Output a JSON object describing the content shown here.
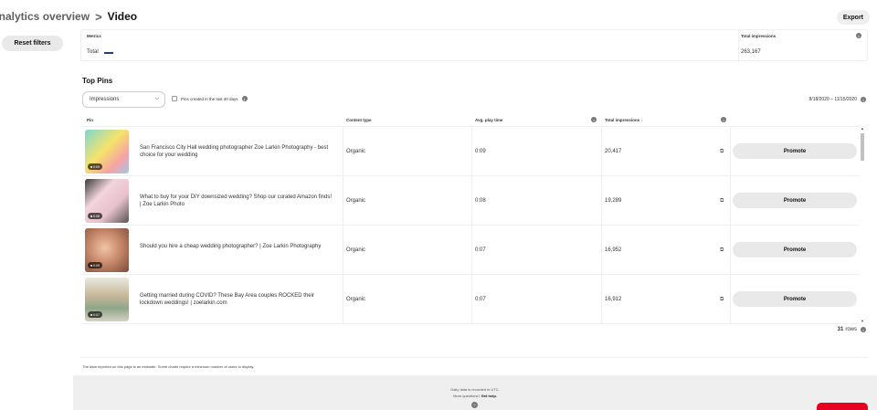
{
  "header": {
    "breadcrumb_parent": "Analytics overview",
    "breadcrumb_sep": ">",
    "breadcrumb_current": "Video",
    "export_label": "Export"
  },
  "sidebar": {
    "reset_label": "Reset filters"
  },
  "metrics": {
    "col_metrics": "Metrics",
    "col_total": "Total impressions",
    "row_label": "Total",
    "row_value": "263,167",
    "line_color": "#1f3c88"
  },
  "top_pins": {
    "title": "Top Pins",
    "select_value": "Impressions",
    "checkbox_label": "Pins created in the last 30 days",
    "date_range": "8/18/2020 – 11/15/2020"
  },
  "table": {
    "headers": {
      "pin": "Pin",
      "content_type": "Content type",
      "play_time": "Avg. play time",
      "impressions": "Total impressions ↓"
    },
    "promote_label": "Promote",
    "rows": [
      {
        "title": "San Francisco City Hall wedding photographer Zoe Larkin Photography - best choice for your wedding",
        "content_type": "Organic",
        "play_time": "0:09",
        "impressions": "20,417",
        "video_tag": "0:09"
      },
      {
        "title": "What to buy for your DIY downsized wedding? Shop our curated Amazon finds! | Zoe Larkin Photo",
        "content_type": "Organic",
        "play_time": "0:08",
        "impressions": "19,289",
        "video_tag": "0:08"
      },
      {
        "title": "Should you hire a cheap wedding photographer? | Zoe Larkin Photography",
        "content_type": "Organic",
        "play_time": "0:07",
        "impressions": "16,952",
        "video_tag": "0:09"
      },
      {
        "title": "Getting married during COVID? These Bay Area couples ROCKED their lockdown weddings! | zoelarkin.com",
        "content_type": "Organic",
        "play_time": "0:07",
        "impressions": "16,912",
        "video_tag": "0:07"
      }
    ],
    "rows_count": "31",
    "rows_label": "rows"
  },
  "disclaimer": "The data reported on this page is an estimate. Some charts require a minimum number of users to display.",
  "footer": {
    "line1": "Daily data is recorded in UTC.",
    "line2_prefix": "More questions?",
    "line2_link": "Get help."
  }
}
